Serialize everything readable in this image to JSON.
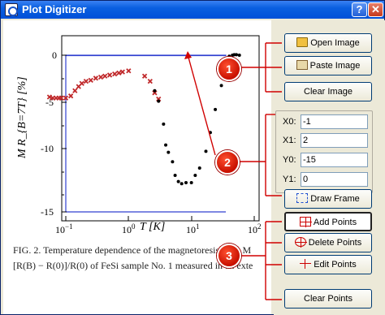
{
  "window": {
    "title": "Plot Digitizer",
    "help_glyph": "?",
    "close_glyph": "✕"
  },
  "buttons": {
    "open_image": "Open Image",
    "paste_image": "Paste Image",
    "clear_image": "Clear Image",
    "draw_frame": "Draw Frame",
    "add_points": "Add Points",
    "delete_points": "Delete Points",
    "edit_points": "Edit Points",
    "clear_points": "Clear Points"
  },
  "calibration": {
    "x0": {
      "label": "X0:",
      "value": "-1"
    },
    "x1": {
      "label": "X1:",
      "value": "2"
    },
    "y0": {
      "label": "Y0:",
      "value": "-15"
    },
    "y1": {
      "label": "Y1:",
      "value": "0"
    }
  },
  "callouts": [
    "1",
    "2",
    "3"
  ],
  "plot": {
    "y_axis_label": "M R_{B=7T} [%]",
    "x_axis_label": "T  [K]",
    "y_ticks": [
      "0",
      "-5",
      "-10",
      "-15"
    ],
    "x_ticks": [
      "10^{-1}",
      "10^{0}",
      "10^{1}",
      "10^{2}"
    ],
    "caption_lines": [
      "FIG. 2. Temperature dependence of the magnetoresistance M",
      "[R(B) − R(0)]/R(0) of FeSi sample No. 1 measured in an exte"
    ]
  },
  "chart_data": {
    "type": "scatter",
    "xlabel": "T [K]",
    "ylabel": "MR_{B=7T} [%]",
    "x_scale": "log",
    "xlim": [
      0.05,
      100
    ],
    "ylim": [
      -15,
      0.5
    ],
    "series": [
      {
        "marker": "x",
        "x": [
          0.055,
          0.062,
          0.07,
          0.078,
          0.085,
          0.1,
          0.12,
          0.14,
          0.16,
          0.18,
          0.21,
          0.25,
          0.3,
          0.36,
          0.42,
          0.5,
          0.6,
          0.7,
          0.8,
          1.0,
          1.8,
          2.2,
          2.6,
          3.0
        ],
        "y": [
          -4.0,
          -4.1,
          -4.1,
          -4.1,
          -4.1,
          -4.1,
          -3.9,
          -3.4,
          -3.0,
          -2.7,
          -2.5,
          -2.4,
          -2.2,
          -2.1,
          -2.0,
          -1.9,
          -1.8,
          -1.7,
          -1.6,
          -1.5,
          -2.0,
          -2.5,
          -3.6,
          -4.2
        ]
      },
      {
        "marker": "dot",
        "x": [
          2.6,
          3.0,
          3.6,
          3.9,
          4.3,
          5.0,
          5.5,
          6.2,
          7.0,
          8.2,
          10.0,
          11.5,
          13.5,
          17.0,
          20.0,
          24.0,
          30.0,
          40.0,
          45.0,
          48.0,
          52.0,
          58.0
        ],
        "y": [
          -3.4,
          -4.4,
          -6.6,
          -8.6,
          -9.3,
          -10.2,
          -11.5,
          -12.1,
          -12.3,
          -12.2,
          -12.2,
          -11.5,
          -10.8,
          -9.2,
          -7.4,
          -5.2,
          -2.9,
          -0.1,
          0.0,
          0.05,
          0.05,
          0.0
        ]
      }
    ]
  }
}
